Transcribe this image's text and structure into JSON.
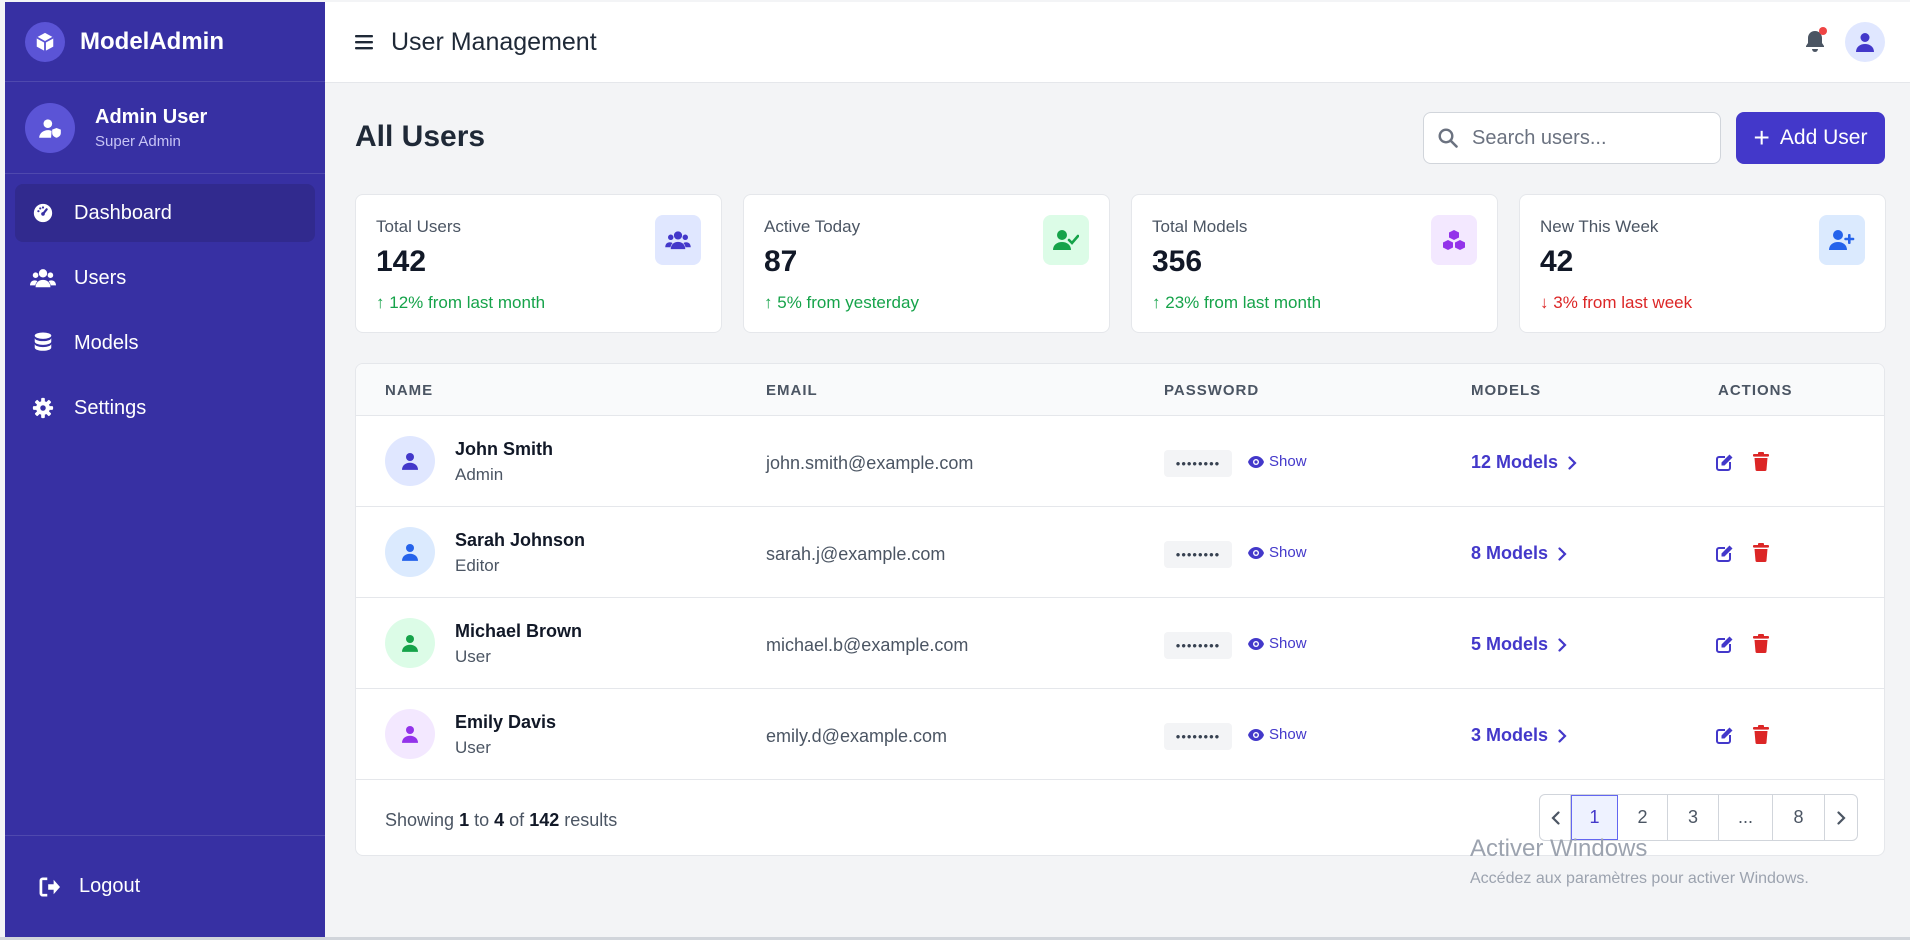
{
  "brand": {
    "name": "ModelAdmin",
    "icon": "cube-icon"
  },
  "profile": {
    "name": "Admin User",
    "role": "Super Admin"
  },
  "nav": {
    "items": [
      {
        "label": "Dashboard",
        "icon": "gauge-icon",
        "active": true
      },
      {
        "label": "Users",
        "icon": "users-icon",
        "active": false
      },
      {
        "label": "Models",
        "icon": "database-icon",
        "active": false
      },
      {
        "label": "Settings",
        "icon": "gear-icon",
        "active": false
      }
    ],
    "logout": "Logout"
  },
  "header": {
    "title": "User Management"
  },
  "main": {
    "heading": "All Users",
    "search_placeholder": "Search users...",
    "add_label": "Add User"
  },
  "stats": [
    {
      "label": "Total Users",
      "value": "142",
      "change": "12% from last month",
      "trend": "up",
      "icon": "users-icon",
      "icon_bg": "#e0e7ff",
      "icon_color": "#4338ca"
    },
    {
      "label": "Active Today",
      "value": "87",
      "change": "5% from yesterday",
      "trend": "up",
      "icon": "user-check-icon",
      "icon_bg": "#dcfce7",
      "icon_color": "#16a34a"
    },
    {
      "label": "Total Models",
      "value": "356",
      "change": "23% from last month",
      "trend": "up",
      "icon": "cubes-icon",
      "icon_bg": "#f3e8ff",
      "icon_color": "#9333ea"
    },
    {
      "label": "New This Week",
      "value": "42",
      "change": "3% from last week",
      "trend": "down",
      "icon": "user-plus-icon",
      "icon_bg": "#dbeafe",
      "icon_color": "#2563eb"
    }
  ],
  "table": {
    "columns": [
      "NAME",
      "EMAIL",
      "PASSWORD",
      "MODELS",
      "ACTIONS"
    ],
    "rows": [
      {
        "name": "John Smith",
        "role": "Admin",
        "email": "john.smith@example.com",
        "password": "••••••••",
        "show": "Show",
        "models": "12 Models",
        "avatar_bg": "#e0e7ff",
        "avatar_color": "#4338ca"
      },
      {
        "name": "Sarah Johnson",
        "role": "Editor",
        "email": "sarah.j@example.com",
        "password": "••••••••",
        "show": "Show",
        "models": "8 Models",
        "avatar_bg": "#dbeafe",
        "avatar_color": "#2563eb"
      },
      {
        "name": "Michael Brown",
        "role": "User",
        "email": "michael.b@example.com",
        "password": "••••••••",
        "show": "Show",
        "models": "5 Models",
        "avatar_bg": "#dcfce7",
        "avatar_color": "#16a34a"
      },
      {
        "name": "Emily Davis",
        "role": "User",
        "email": "emily.d@example.com",
        "password": "••••••••",
        "show": "Show",
        "models": "3 Models",
        "avatar_bg": "#f3e8ff",
        "avatar_color": "#9333ea"
      }
    ]
  },
  "footer": {
    "showing_prefix": "Showing",
    "from": "1",
    "to_word": "to",
    "to": "4",
    "of_word": "of",
    "total": "142",
    "suffix": "results"
  },
  "pagination": {
    "pages": [
      "1",
      "2",
      "3",
      "...",
      "8"
    ],
    "current": "1"
  },
  "watermark": {
    "title": "Activer Windows",
    "subtitle": "Accédez aux paramètres pour activer Windows."
  },
  "colors": {
    "sidebar": "#3730a3",
    "accent": "#4338ca",
    "up": "#16a34a",
    "down": "#dc2626",
    "delete": "#dc2626"
  }
}
